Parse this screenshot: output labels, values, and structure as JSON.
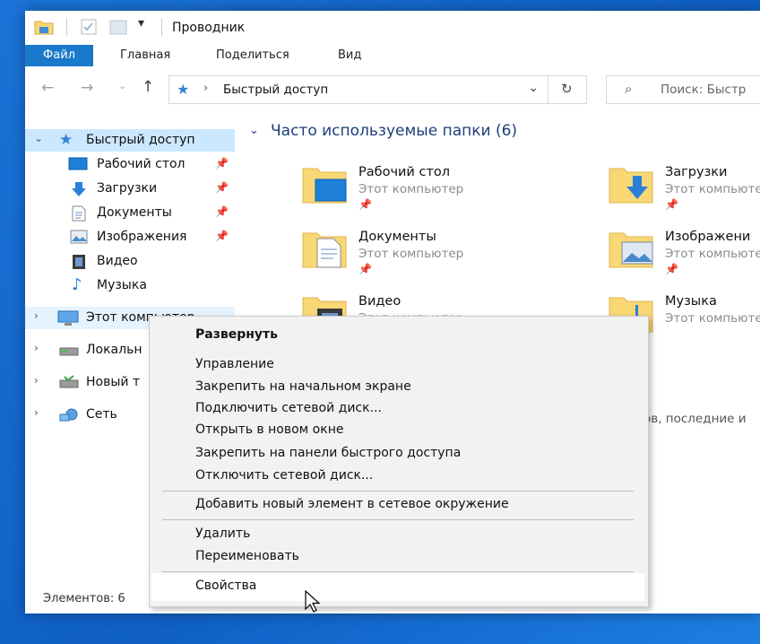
{
  "window": {
    "title": "Проводник"
  },
  "ribbon": {
    "tabs": [
      "Файл",
      "Главная",
      "Поделиться",
      "Вид"
    ]
  },
  "address": {
    "path": "Быстрый доступ",
    "search_placeholder": "Поиск: Быстр"
  },
  "sidebar": {
    "quick_access": "Быстрый доступ",
    "pinned": [
      {
        "label": "Рабочий стол",
        "icon": "desktop-icon"
      },
      {
        "label": "Загрузки",
        "icon": "downloads-icon"
      },
      {
        "label": "Документы",
        "icon": "documents-icon"
      },
      {
        "label": "Изображения",
        "icon": "pictures-icon"
      },
      {
        "label": "Видео",
        "icon": "video-icon"
      },
      {
        "label": "Музыка",
        "icon": "music-icon"
      }
    ],
    "this_pc": "Этот компьютер",
    "local": "Локальн",
    "new_volume": "Новый т",
    "network": "Сеть"
  },
  "content": {
    "section_title": "Часто используемые папки (6)",
    "folders": [
      {
        "name": "Рабочий стол",
        "location": "Этот компьютер"
      },
      {
        "name": "Загрузки",
        "location": "Этот компьютер"
      },
      {
        "name": "Документы",
        "location": "Этот компьютер"
      },
      {
        "name": "Изображени",
        "location": "Этот компьютер"
      },
      {
        "name": "Видео",
        "location": "Этот компьютер"
      },
      {
        "name": "Музыка",
        "location": "Этот компьютер"
      }
    ],
    "recent_fragment": "ов, последние и"
  },
  "status": {
    "items": "Элементов: 6"
  },
  "context_menu": {
    "expand": "Развернуть",
    "group1": [
      "Управление",
      "Закрепить на начальном экране",
      "Подключить сетевой диск...",
      "Открыть в новом окне",
      "Закрепить на панели быстрого доступа",
      "Отключить сетевой диск..."
    ],
    "group2": [
      "Добавить новый элемент в сетевое окружение"
    ],
    "group3": [
      "Удалить",
      "Переименовать"
    ],
    "properties": "Свойства"
  },
  "colors": {
    "accent": "#1979ca",
    "selection": "#cce8ff",
    "folder": "#f8d775"
  }
}
